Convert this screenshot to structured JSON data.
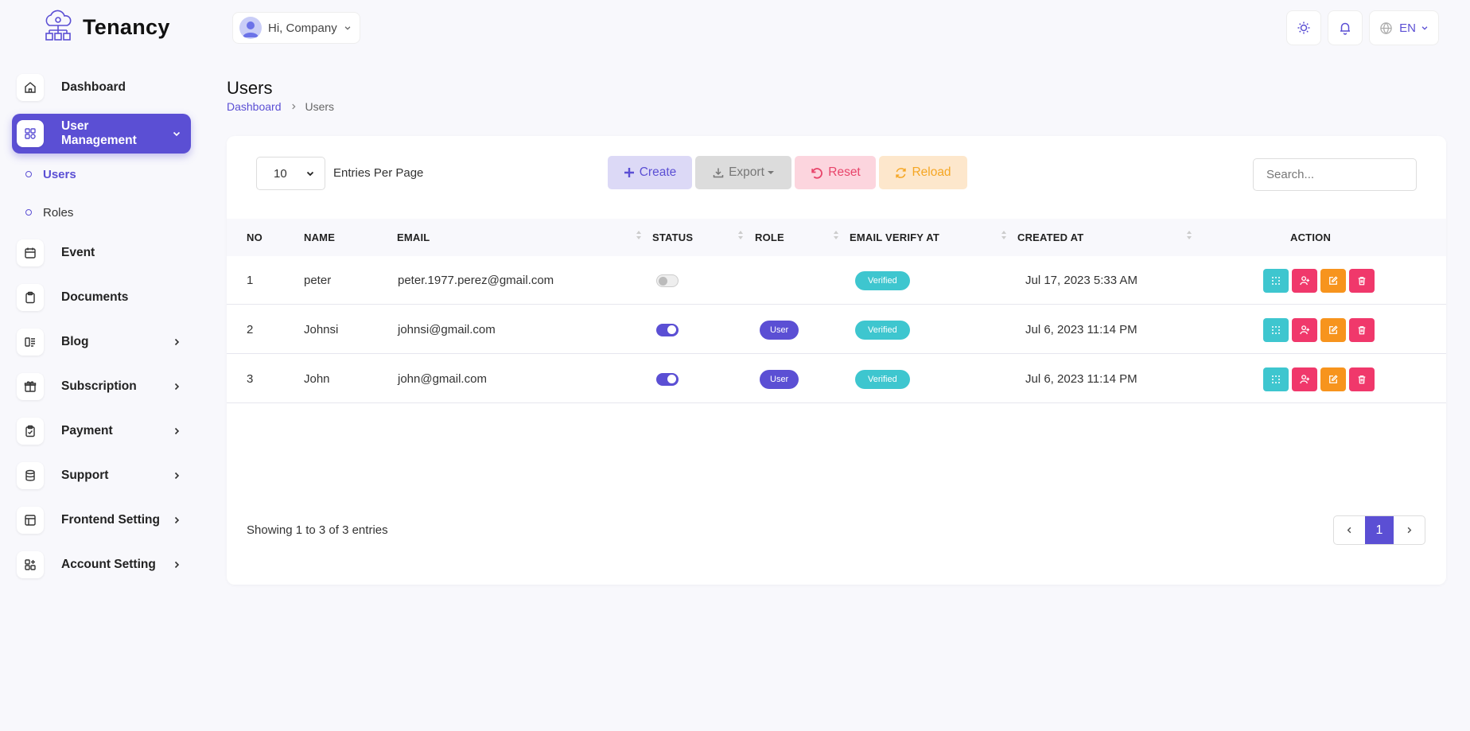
{
  "app": {
    "name": "Tenancy"
  },
  "header": {
    "greeting": "Hi, Company",
    "language": "EN"
  },
  "sidebar": {
    "items": [
      {
        "label": "Dashboard"
      },
      {
        "label": "User Management"
      },
      {
        "label": "Event"
      },
      {
        "label": "Documents"
      },
      {
        "label": "Blog"
      },
      {
        "label": "Subscription"
      },
      {
        "label": "Payment"
      },
      {
        "label": "Support"
      },
      {
        "label": "Frontend Setting"
      },
      {
        "label": "Account Setting"
      }
    ],
    "subitems": [
      {
        "label": "Users"
      },
      {
        "label": "Roles"
      }
    ]
  },
  "page": {
    "title": "Users",
    "breadcrumb": {
      "home": "Dashboard",
      "current": "Users"
    }
  },
  "toolbar": {
    "entries_value": "10",
    "entries_label": "Entries Per Page",
    "create": "Create",
    "export": "Export",
    "reset": "Reset",
    "reload": "Reload",
    "search_placeholder": "Search..."
  },
  "table": {
    "columns": [
      "NO",
      "NAME",
      "EMAIL",
      "STATUS",
      "ROLE",
      "EMAIL VERIFY AT",
      "CREATED AT",
      "ACTION"
    ],
    "rows": [
      {
        "no": "1",
        "name": "peter",
        "email": "peter.1977.perez@gmail.com",
        "status": "off",
        "role": "",
        "verify": "Verified",
        "created": "Jul 17, 2023 5:33 AM"
      },
      {
        "no": "2",
        "name": "Johnsi",
        "email": "johnsi@gmail.com",
        "status": "on",
        "role": "User",
        "verify": "Verified",
        "created": "Jul 6, 2023 11:14 PM"
      },
      {
        "no": "3",
        "name": "John",
        "email": "john@gmail.com",
        "status": "on",
        "role": "User",
        "verify": "Verified",
        "created": "Jul 6, 2023 11:14 PM"
      }
    ]
  },
  "footer": {
    "showing": "Showing 1 to 3 of 3 entries",
    "current_page": "1"
  },
  "colors": {
    "accent": "#5b4fd4",
    "teal": "#3ec6cf",
    "pink": "#f0386b",
    "orange": "#f7941d"
  }
}
